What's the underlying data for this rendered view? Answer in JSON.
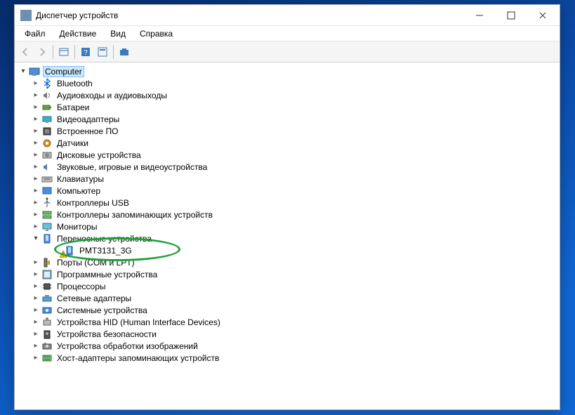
{
  "window": {
    "title": "Диспетчер устройств"
  },
  "menu": {
    "file": "Файл",
    "action": "Действие",
    "view": "Вид",
    "help": "Справка"
  },
  "tree": {
    "root": "Computer",
    "items": [
      "Bluetooth",
      "Аудиовходы и аудиовыходы",
      "Батареи",
      "Видеоадаптеры",
      "Встроенное ПО",
      "Датчики",
      "Дисковые устройства",
      "Звуковые, игровые и видеоустройства",
      "Клавиатуры",
      "Компьютер",
      "Контроллеры USB",
      "Контроллеры запоминающих устройств",
      "Мониторы",
      "Переносные устройства",
      "PMT3131_3G",
      "Порты (COM и LPT)",
      "Программные устройства",
      "Процессоры",
      "Сетевые адаптеры",
      "Системные устройства",
      "Устройства HID (Human Interface Devices)",
      "Устройства безопасности",
      "Устройства обработки изображений",
      "Хост-адаптеры запоминающих устройств"
    ]
  }
}
